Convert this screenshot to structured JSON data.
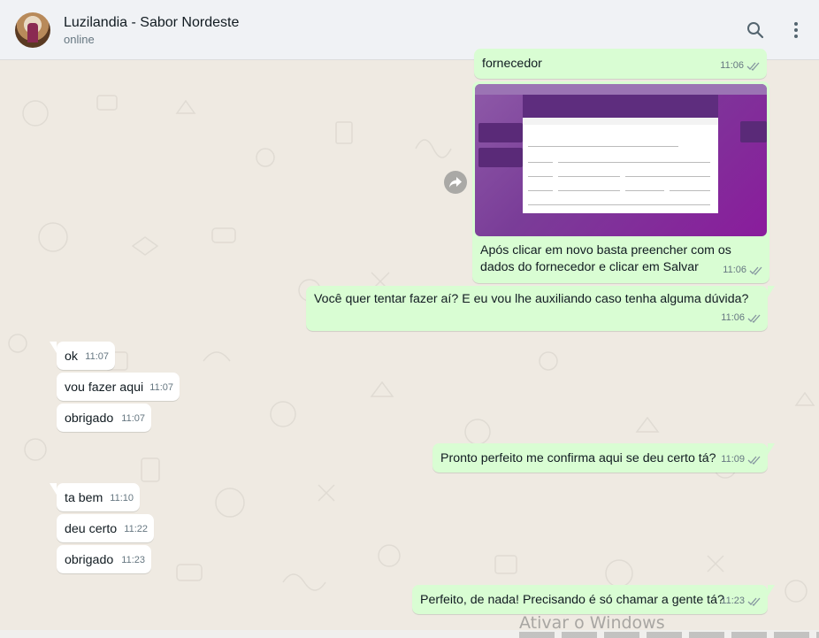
{
  "header": {
    "contact_name": "Luzilandia  - Sabor Nordeste",
    "status": "online"
  },
  "icons": {
    "search": "search-icon",
    "menu": "more-vertical-icon",
    "forward": "forward-icon",
    "read_receipt": "double-check-icon"
  },
  "colors": {
    "outgoing_bubble": "#d9fdd3",
    "incoming_bubble": "#ffffff",
    "chat_background": "#efeae2",
    "header_background": "#f0f2f5",
    "read_tick": "#8696a0"
  },
  "messages": [
    {
      "dir": "out",
      "text": "fornecedor",
      "time": "11:06"
    },
    {
      "dir": "out",
      "type": "image",
      "caption": "Após clicar em novo basta preencher com os dados do fornecedor e clicar em Salvar",
      "time": "11:06"
    },
    {
      "dir": "out",
      "text": "Você quer tentar fazer aí? E eu vou lhe auxiliando caso tenha alguma dúvida?",
      "time": "11:06"
    },
    {
      "dir": "in",
      "text": "ok",
      "time": "11:07"
    },
    {
      "dir": "in",
      "text": "vou fazer aqui",
      "time": "11:07"
    },
    {
      "dir": "in",
      "text": "obrigado",
      "time": "11:07"
    },
    {
      "dir": "out",
      "text": "Pronto perfeito me confirma aqui se deu certo tá?",
      "time": "11:09"
    },
    {
      "dir": "in",
      "text": "ta bem",
      "time": "11:10"
    },
    {
      "dir": "in",
      "text": "deu certo",
      "time": "11:22"
    },
    {
      "dir": "in",
      "text": "obrigado",
      "time": "11:23"
    },
    {
      "dir": "out",
      "text": "Perfeito, de nada! Precisando é só chamar a gente tá?",
      "time": "11:23"
    }
  ],
  "watermark": "Ativar o Windows"
}
